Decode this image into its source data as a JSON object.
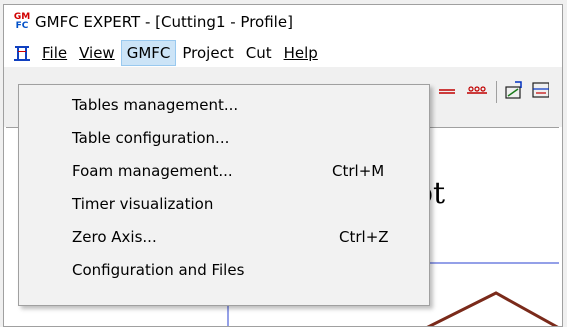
{
  "window": {
    "title": "GMFC EXPERT - [Cutting1 - Profile]",
    "logo_top": "GM",
    "logo_bottom": "FC"
  },
  "menubar": {
    "items": [
      {
        "label": "File"
      },
      {
        "label": "View"
      },
      {
        "label": "GMFC"
      },
      {
        "label": "Project"
      },
      {
        "label": "Cut"
      },
      {
        "label": "Help"
      }
    ],
    "active": "GMFC"
  },
  "dropdown": {
    "items": [
      {
        "label": "Tables management...",
        "shortcut": ""
      },
      {
        "label": "Table configuration...",
        "shortcut": ""
      },
      {
        "label": "Foam management...",
        "shortcut": "Ctrl+M"
      },
      {
        "label": "Timer visualization",
        "shortcut": ""
      },
      {
        "label": "Zero Axis...",
        "shortcut": "Ctrl+Z"
      },
      {
        "label": "Configuration and Files",
        "shortcut": ""
      }
    ]
  },
  "canvas": {
    "partial_text": "ot"
  },
  "colors": {
    "menu_highlight": "#cce4f7",
    "menu_highlight_border": "#99c9ef",
    "shape_stroke": "#7a2a1a",
    "axis_blue": "#2a40d0"
  }
}
